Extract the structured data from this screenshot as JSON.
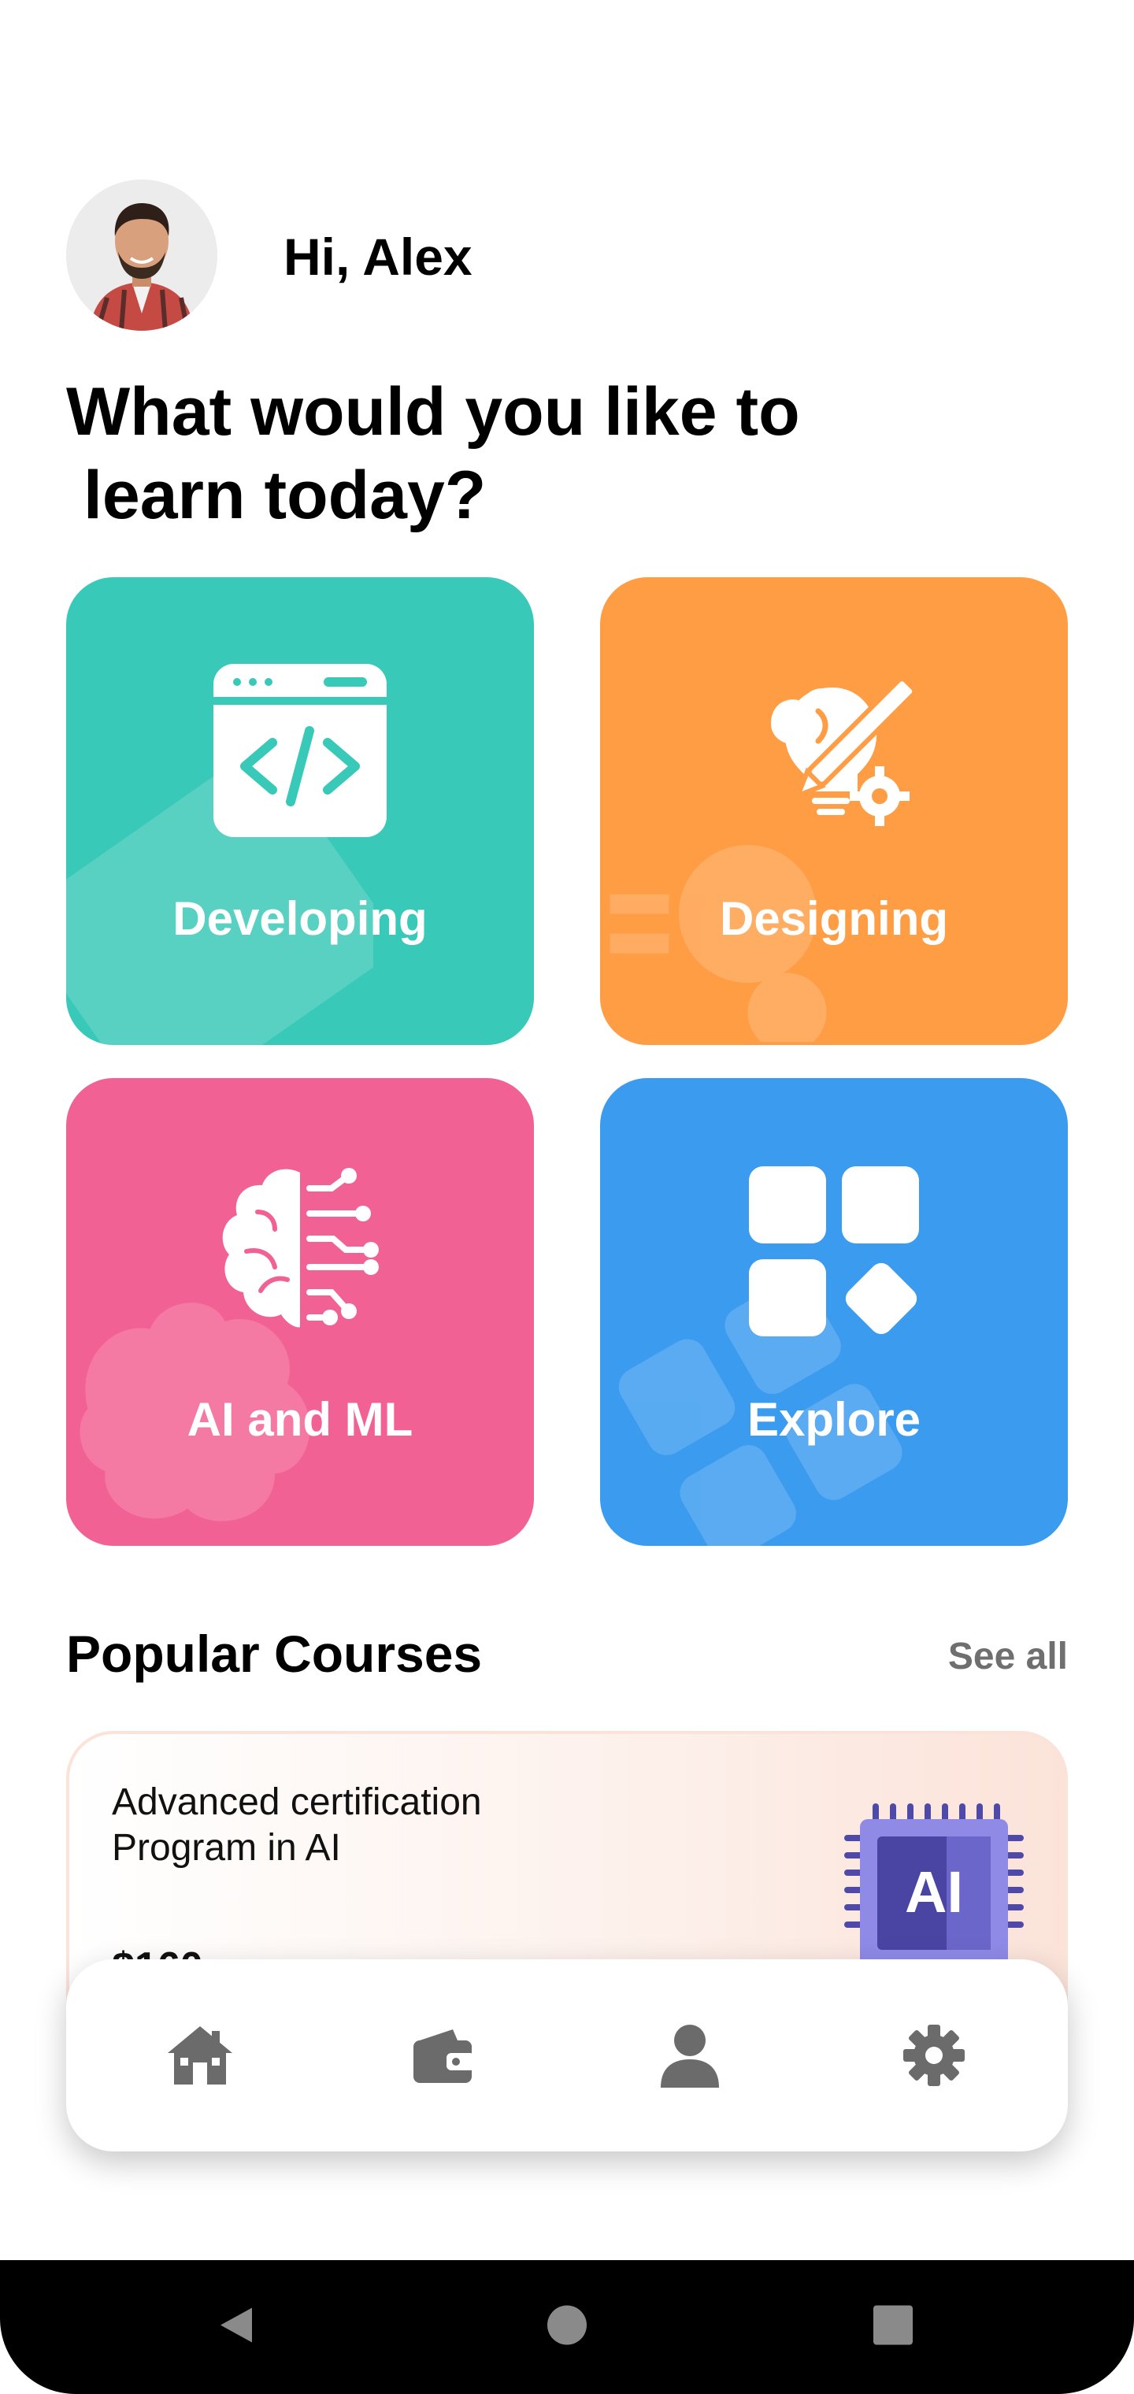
{
  "greeting": "Hi, Alex",
  "headline": {
    "line1": "What would you like to",
    "line2": "learn today?"
  },
  "categories": [
    {
      "label": "Developing",
      "icon": "code-window-icon",
      "color": "#38c9b8"
    },
    {
      "label": "Designing",
      "icon": "creative-bulb-icon",
      "color": "#ff9d45"
    },
    {
      "label": "AI and ML",
      "icon": "ai-brain-icon",
      "color": "#f26193"
    },
    {
      "label": "Explore",
      "icon": "apps-grid-icon",
      "color": "#3a9bef"
    }
  ],
  "popular": {
    "title": "Popular Courses",
    "see_all": "See all",
    "courses": [
      {
        "title_line1": "Advanced certification",
        "title_line2": "Program in AI",
        "price": "$160",
        "icon": "ai-chip-icon",
        "chip_text": "AI"
      }
    ]
  },
  "nav": [
    "home-icon",
    "wallet-icon",
    "profile-icon",
    "settings-icon"
  ],
  "system_nav": [
    "back-icon",
    "home-circle-icon",
    "recents-icon"
  ]
}
